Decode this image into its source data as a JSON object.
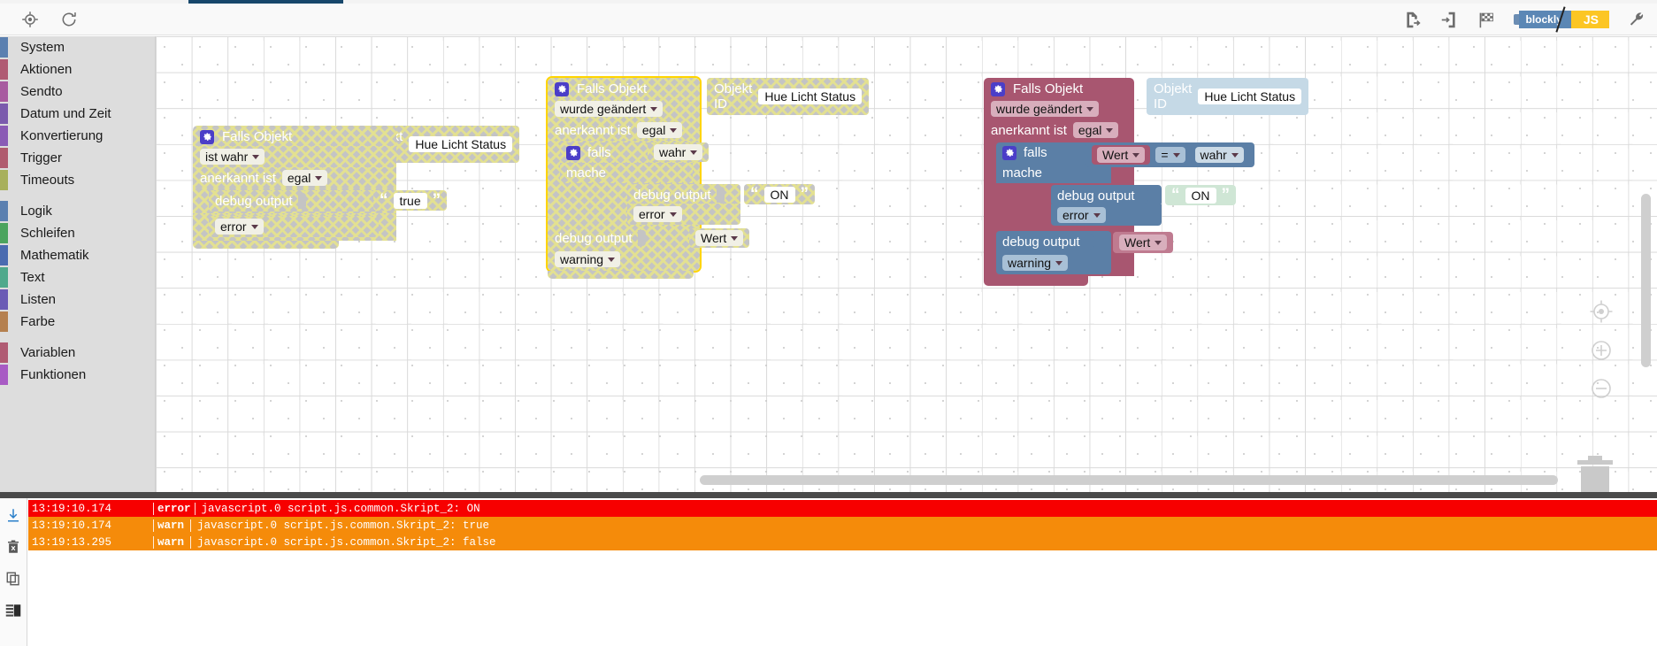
{
  "toolbar": {
    "left_icons": [
      {
        "name": "center-blocks-icon",
        "label": "Blöcke zentrieren"
      },
      {
        "name": "reload-icon",
        "label": "Neu laden"
      }
    ],
    "right_icons": [
      {
        "name": "export-blocks-icon",
        "label": "Blöcke exportieren"
      },
      {
        "name": "import-blocks-icon",
        "label": "Blöcke importieren"
      },
      {
        "name": "checkered-flag-icon",
        "label": "Start"
      },
      {
        "name": "wrench-icon",
        "label": "Einstellungen"
      }
    ],
    "mode_toggle": {
      "left_label": "blockly",
      "right_label": "JS",
      "active": "JS"
    }
  },
  "toolbox": {
    "groups": [
      {
        "items": [
          {
            "label": "System",
            "color": "#5b80b0"
          },
          {
            "label": "Aktionen",
            "color": "#b05b73"
          },
          {
            "label": "Sendto",
            "color": "#a85ba0"
          },
          {
            "label": "Datum und Zeit",
            "color": "#7b5bad"
          },
          {
            "label": "Konvertierung",
            "color": "#8a5bb5"
          },
          {
            "label": "Trigger",
            "color": "#b05b6e"
          },
          {
            "label": "Timeouts",
            "color": "#a8b05b"
          }
        ]
      },
      {
        "items": [
          {
            "label": "Logik",
            "color": "#5b80b0"
          },
          {
            "label": "Schleifen",
            "color": "#4ba45e"
          },
          {
            "label": "Mathematik",
            "color": "#4a6bb0"
          },
          {
            "label": "Text",
            "color": "#4fa98c"
          },
          {
            "label": "Listen",
            "color": "#6b5bb5"
          },
          {
            "label": "Farbe",
            "color": "#b5804f"
          }
        ]
      },
      {
        "items": [
          {
            "label": "Variablen",
            "color": "#b05b73"
          },
          {
            "label": "Funktionen",
            "color": "#a85bc4"
          }
        ]
      }
    ]
  },
  "workspace": {
    "zoom_controls": [
      {
        "name": "zoom-center-icon",
        "label": "Zentrieren"
      },
      {
        "name": "zoom-in-icon",
        "label": "Vergrößern"
      },
      {
        "name": "zoom-out-icon",
        "label": "Verkleinern"
      }
    ],
    "trashcan": {
      "name": "trashcan-icon",
      "label": "Papierkorb"
    },
    "blocks": [
      {
        "id": "block-1",
        "state": "disabled",
        "trigger": "Falls Objekt",
        "object_id_label": "Objekt ID",
        "object_id_value": "Hue Licht Status",
        "condition": "ist wahr",
        "ack_label": "anerkannt ist",
        "ack_value": "egal",
        "statements": [
          {
            "label": "debug output",
            "text_value": "true",
            "severity": "error"
          }
        ]
      },
      {
        "id": "block-2",
        "state": "disabled-selected",
        "trigger": "Falls Objekt",
        "object_id_label": "Objekt ID",
        "object_id_value": "Hue Licht Status",
        "condition": "wurde geändert",
        "ack_label": "anerkannt ist",
        "ack_value": "egal",
        "if_label": "falls",
        "if_value": "wahr",
        "do_label": "mache",
        "inner_statement": {
          "label": "debug output",
          "text_value": "ON",
          "severity": "error"
        },
        "outer_statement": {
          "label": "debug output",
          "value_field": "Wert",
          "severity": "warning"
        }
      },
      {
        "id": "block-3",
        "state": "enabled",
        "trigger": "Falls Objekt",
        "object_id_label": "Objekt ID",
        "object_id_value": "Hue Licht Status",
        "condition": "wurde geändert",
        "ack_label": "anerkannt ist",
        "ack_value": "egal",
        "if_label": "falls",
        "compare": {
          "left": "Wert",
          "operator": "=",
          "right": "wahr"
        },
        "do_label": "mache",
        "inner_statement": {
          "label": "debug output",
          "text_value": "ON",
          "severity": "error"
        },
        "outer_statement": {
          "label": "debug output",
          "value_field": "Wert",
          "severity": "warning"
        }
      }
    ]
  },
  "log": {
    "tools": [
      {
        "name": "scroll-to-bottom-icon",
        "label": "Ans Ende scrollen"
      },
      {
        "name": "clear-log-icon",
        "label": "Log leeren"
      },
      {
        "name": "copy-log-icon",
        "label": "Kopieren"
      },
      {
        "name": "layout-toggle-icon",
        "label": "Ansicht umschalten"
      }
    ],
    "rows": [
      {
        "time": "13:19:10.174",
        "severity": "error",
        "message": "javascript.0 script.js.common.Skript_2: ON"
      },
      {
        "time": "13:19:10.174",
        "severity": "warn",
        "message": "javascript.0 script.js.common.Skript_2: true"
      },
      {
        "time": "13:19:13.295",
        "severity": "warn",
        "message": "javascript.0 script.js.common.Skript_2: false"
      }
    ]
  },
  "colors": {
    "error_bg": "#f70000",
    "warn_bg": "#f58b0a",
    "tab_accent": "#17476b",
    "selection": "#ffd400",
    "block_trigger": "#a85670",
    "block_logic": "#5b7fa6",
    "block_text": "#cfe6d5",
    "block_objectid": "#c5d9e6"
  }
}
